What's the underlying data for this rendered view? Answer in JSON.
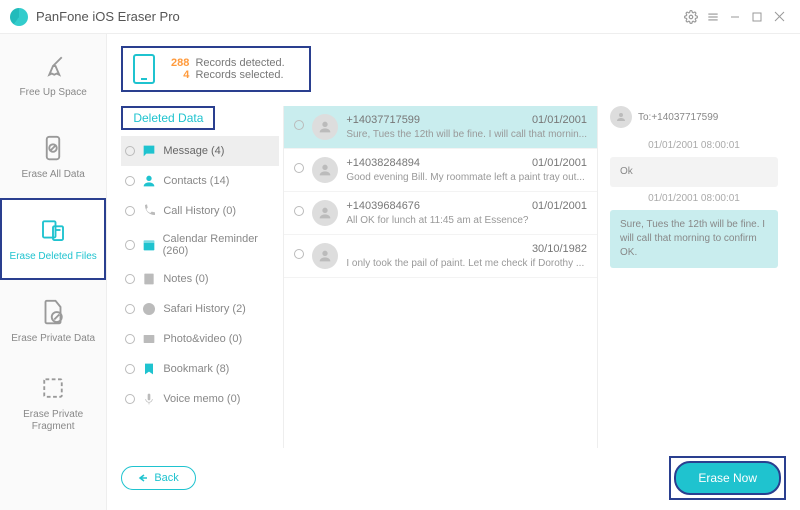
{
  "app": {
    "title": "PanFone iOS Eraser Pro"
  },
  "sidebar": {
    "items": [
      {
        "label": "Free Up Space"
      },
      {
        "label": "Erase All Data"
      },
      {
        "label": "Erase Deleted Files"
      },
      {
        "label": "Erase Private Data"
      },
      {
        "label": "Erase Private Fragment"
      }
    ]
  },
  "stats": {
    "detected_n": "288",
    "detected_t": "Records detected.",
    "selected_n": "4",
    "selected_t": "Records selected."
  },
  "cats_header": "Deleted Data",
  "cats": [
    {
      "label": "Message (4)"
    },
    {
      "label": "Contacts (14)"
    },
    {
      "label": "Call History (0)"
    },
    {
      "label": "Calendar Reminder (260)"
    },
    {
      "label": "Notes (0)"
    },
    {
      "label": "Safari History (2)"
    },
    {
      "label": "Photo&video (0)"
    },
    {
      "label": "Bookmark (8)"
    },
    {
      "label": "Voice memo (0)"
    }
  ],
  "msgs": [
    {
      "from": "+14037717599",
      "date": "01/01/2001",
      "preview": "Sure, Tues the 12th will be fine. I will call that mornin..."
    },
    {
      "from": "+14038284894",
      "date": "01/01/2001",
      "preview": "Good evening Bill. My roommate left a paint tray out..."
    },
    {
      "from": "+14039684676",
      "date": "01/01/2001",
      "preview": "All OK for lunch at 11:45 am at Essence?"
    },
    {
      "from": "",
      "date": "30/10/1982",
      "preview": "I only took the pail of paint. Let me check if Dorothy ..."
    }
  ],
  "preview": {
    "to": "To:+14037717599",
    "thread": [
      {
        "ts": "01/01/2001 08:00:01",
        "text": "Ok",
        "me": false
      },
      {
        "ts": "01/01/2001 08:00:01",
        "text": "Sure, Tues the 12th will be fine. I will call that morning to confirm OK.",
        "me": true
      }
    ]
  },
  "buttons": {
    "back": "Back",
    "erase": "Erase Now"
  }
}
